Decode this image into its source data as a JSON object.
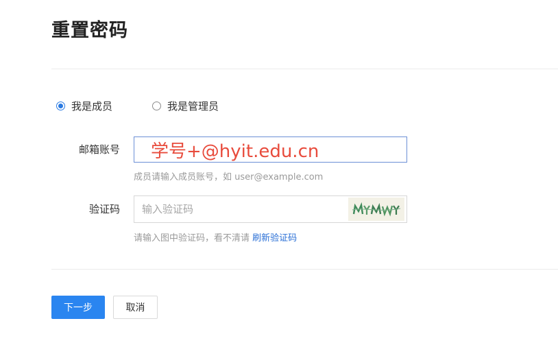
{
  "page": {
    "title": "重置密码"
  },
  "roles": [
    {
      "label": "我是成员",
      "checked": true
    },
    {
      "label": "我是管理员",
      "checked": false
    }
  ],
  "email_field": {
    "label": "邮箱账号",
    "value": "学号+@hyit.edu.cn",
    "value_color": "#e84b3c",
    "hint": "成员请输入成员账号，如 user@example.com"
  },
  "captcha_field": {
    "label": "验证码",
    "placeholder": "输入验证码",
    "hint": "请输入图中验证码，看不清请",
    "refresh_link": "刷新验证码"
  },
  "actions": {
    "next_label": "下一步",
    "cancel_label": "取消"
  },
  "colors": {
    "accent": "#2a85f0",
    "link": "#2a6fd6"
  }
}
